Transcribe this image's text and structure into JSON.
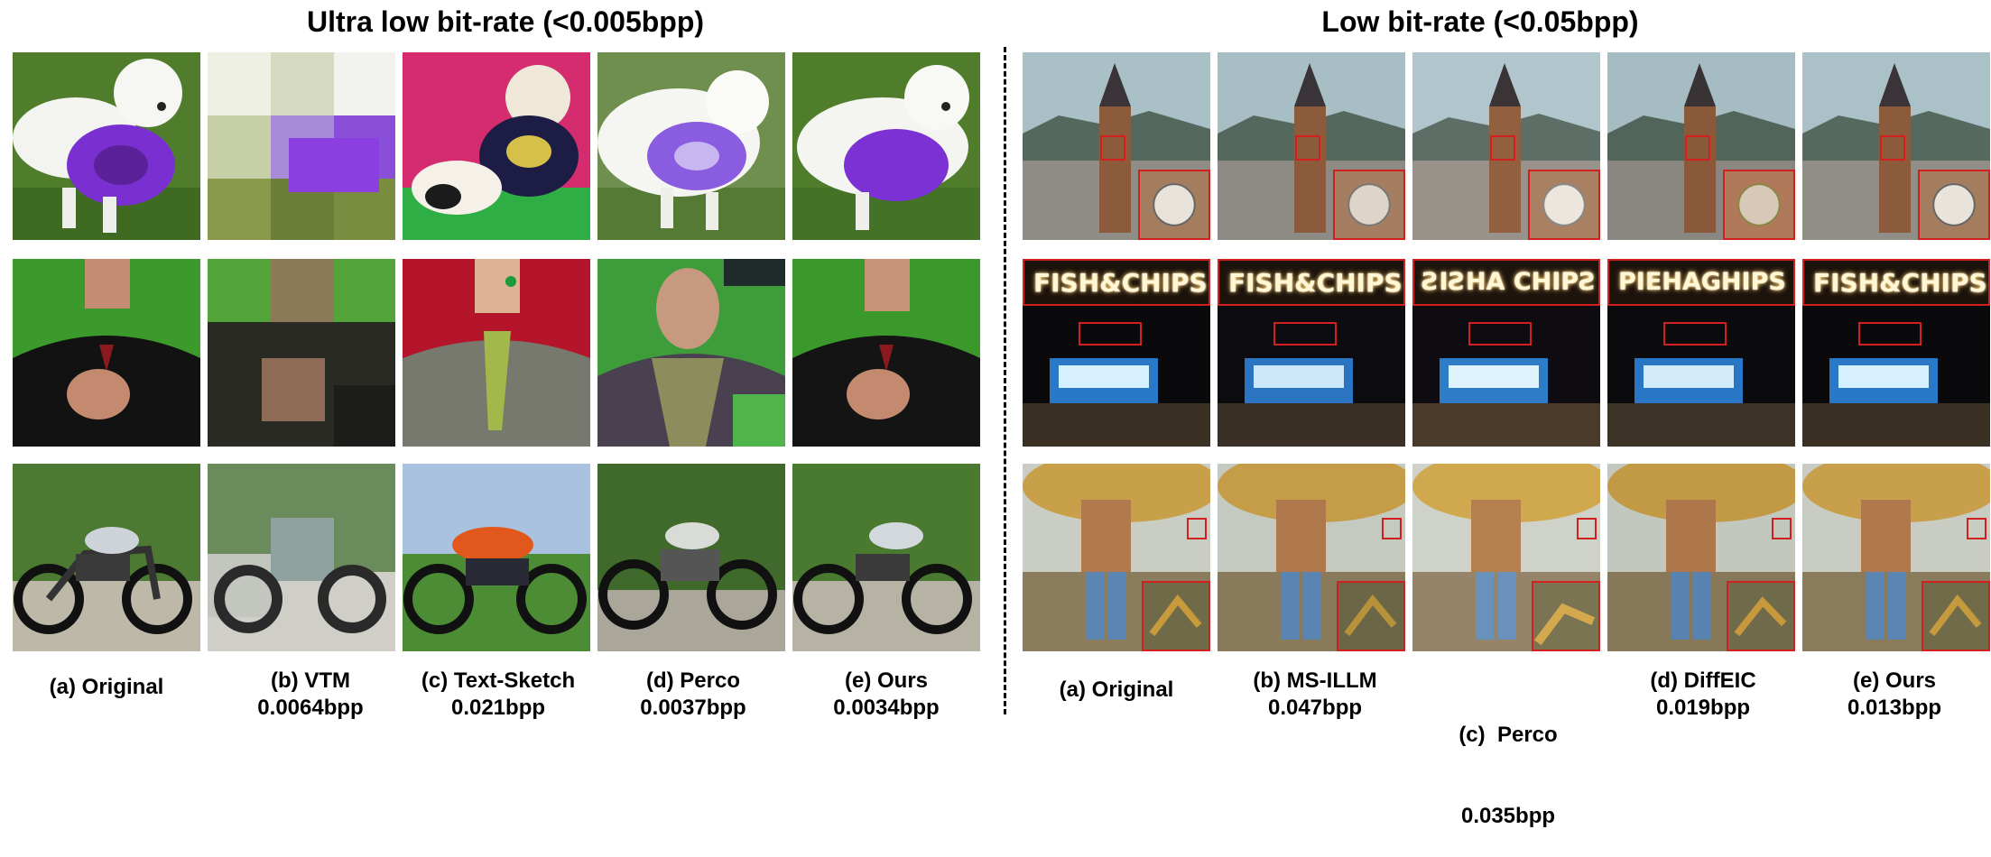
{
  "left_panel": {
    "title": "Ultra low bit-rate (<0.005bpp)",
    "captions": [
      {
        "label": "(a) Original",
        "bpp": ""
      },
      {
        "label": "(b) VTM",
        "bpp": "0.0064bpp"
      },
      {
        "label": "(c) Text-Sketch",
        "bpp": "0.021bpp"
      },
      {
        "label": "(d) Perco",
        "bpp": "0.0037bpp"
      },
      {
        "label": "(e) Ours",
        "bpp": "0.0034bpp"
      }
    ]
  },
  "right_panel": {
    "title": "Low bit-rate (<0.05bpp)",
    "captions": [
      {
        "label": "(a) Original",
        "bpp": ""
      },
      {
        "label": "(b) MS-ILLM",
        "bpp": "0.047bpp"
      },
      {
        "label": "(c)  Perco",
        "bpp": "0.035bpp"
      },
      {
        "label": "(d) DiffEIC",
        "bpp": "0.019bpp"
      },
      {
        "label": "(e) Ours",
        "bpp": "0.013bpp"
      }
    ],
    "sign_texts": [
      "FISH&CHIPS",
      "FISH&CHIPS",
      "ƧIƧHA CHIPƧ",
      "PIEHAGHIPS",
      "FISH&CHIPS"
    ]
  }
}
